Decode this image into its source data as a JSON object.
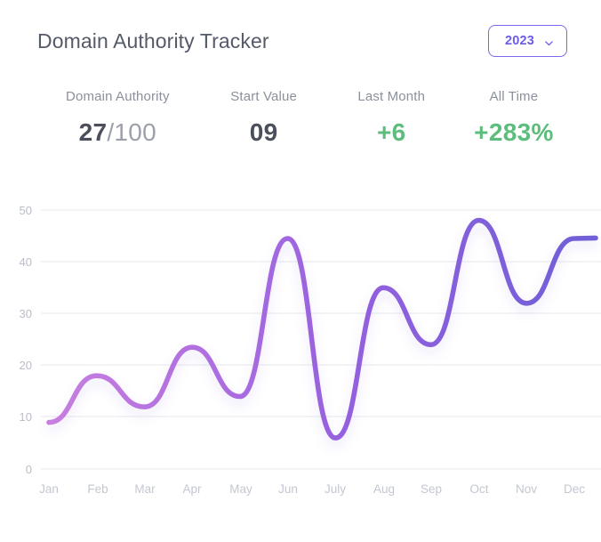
{
  "header": {
    "title": "Domain Authority Tracker",
    "year_selector": {
      "value": "2023",
      "icon": "chevron-down-icon"
    }
  },
  "stats": [
    {
      "label": "Domain Authority",
      "value": "27",
      "suffix": "/100",
      "tone": "neutral"
    },
    {
      "label": "Start Value",
      "value": "09",
      "suffix": "",
      "tone": "neutral"
    },
    {
      "label": "Last Month",
      "value": "+6",
      "suffix": "",
      "tone": "positive"
    },
    {
      "label": "All Time",
      "value": "+283%",
      "suffix": "",
      "tone": "positive"
    }
  ],
  "colors": {
    "accent_purple": "#6c5ce7",
    "line_start": "#c77ee0",
    "line_end": "#6f5fd8",
    "positive_green": "#5cbd7c",
    "title_gray": "#555a68",
    "label_gray": "#8b909c",
    "grid_gray": "#eef0f3"
  },
  "chart_data": {
    "type": "line",
    "title": "",
    "xlabel": "",
    "ylabel": "",
    "categories": [
      "Jan",
      "Feb",
      "Mar",
      "Apr",
      "May",
      "Jun",
      "July",
      "Aug",
      "Sep",
      "Oct",
      "Nov",
      "Dec"
    ],
    "values": [
      9,
      18,
      12,
      23.5,
      14,
      44.5,
      6,
      35,
      24,
      48,
      32,
      44.5
    ],
    "ylim": [
      0,
      50
    ],
    "yticks": [
      0,
      10,
      20,
      30,
      40,
      50
    ],
    "grid": true,
    "legend": "none",
    "series": [
      {
        "name": "Domain Authority",
        "values": [
          9,
          18,
          12,
          23.5,
          14,
          44.5,
          6,
          35,
          24,
          48,
          32,
          44.5
        ]
      }
    ]
  }
}
